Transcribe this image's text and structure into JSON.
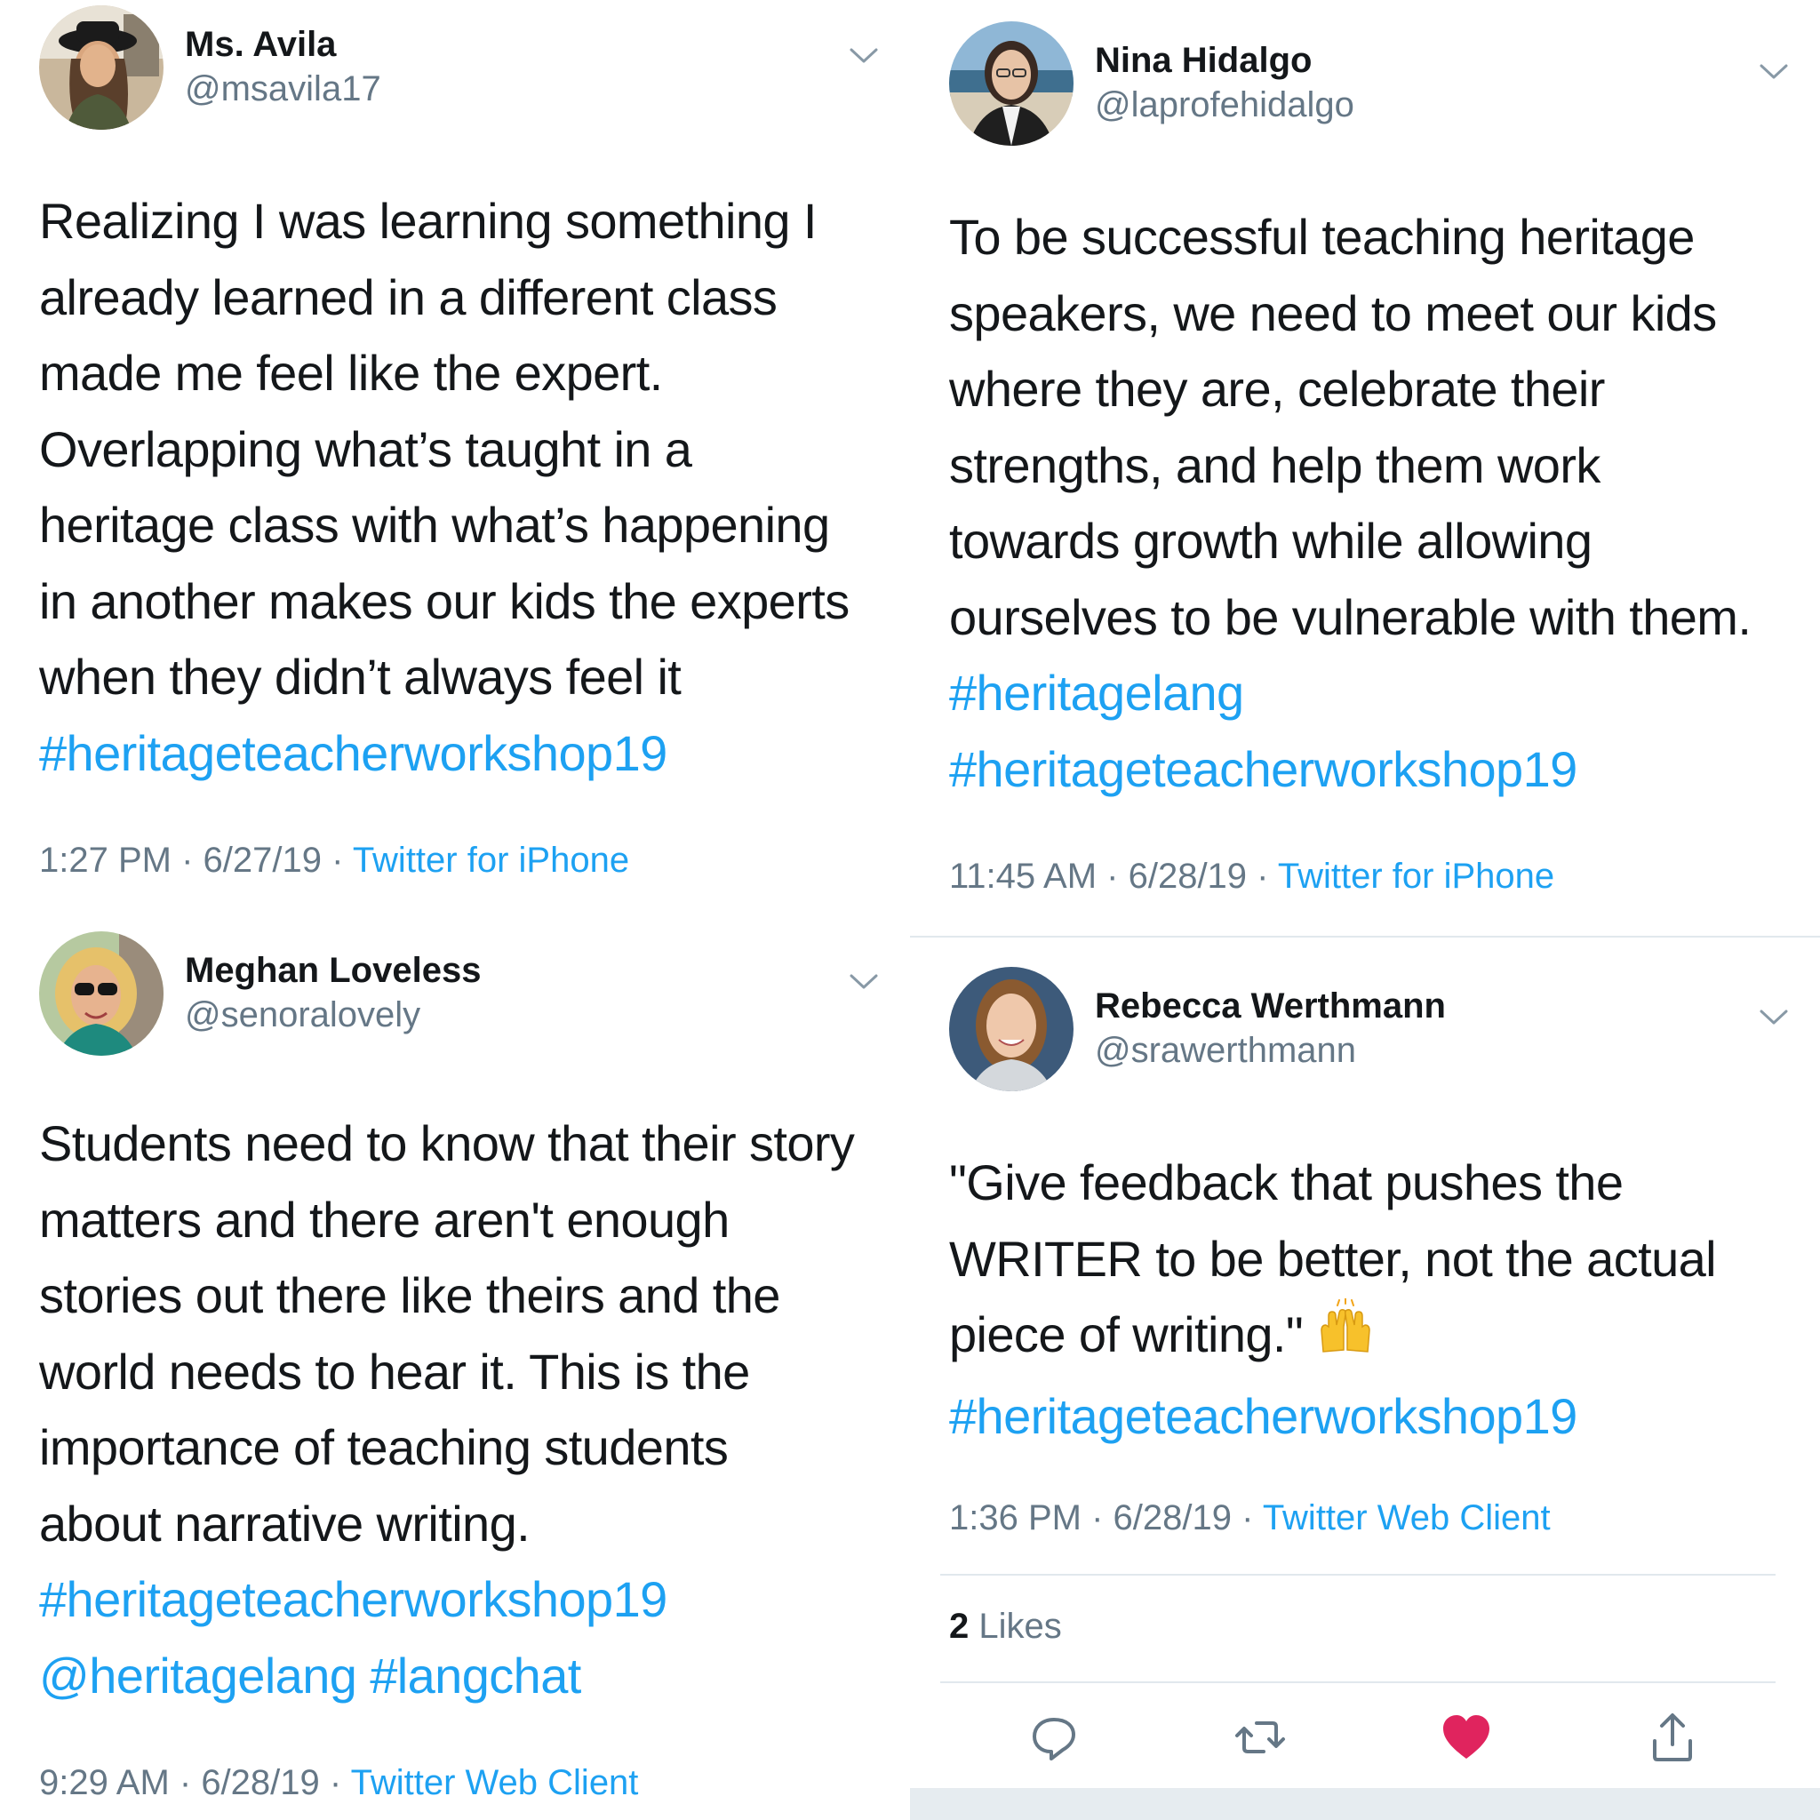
{
  "tweets": [
    {
      "name": "Ms. Avila",
      "handle": "@msavila17",
      "lines": [
        "Realizing I was learning something I",
        "already learned in a different class",
        "made me feel like the expert.",
        "Overlapping what’s taught in a",
        "heritage class with what’s happening",
        "in another makes our kids the experts",
        "when they didn’t always feel it"
      ],
      "hashtags": [
        "#heritageteacherworkshop19"
      ],
      "time": "1:27 PM",
      "date": "6/27/19",
      "source": "Twitter for iPhone"
    },
    {
      "name": "Nina Hidalgo",
      "handle": "@laprofehidalgo",
      "lines": [
        "To be successful teaching heritage",
        "speakers, we need to meet our kids",
        "where they are, celebrate their",
        "strengths, and help them work",
        "towards growth while allowing",
        "ourselves to be vulnerable with them."
      ],
      "hashtags": [
        "#heritagelang",
        "#heritageteacherworkshop19"
      ],
      "time": "11:45 AM",
      "date": "6/28/19",
      "source": "Twitter for iPhone"
    },
    {
      "name": "Meghan Loveless",
      "handle": "@senoralovely",
      "lines": [
        "Students need to know that their story",
        "matters and there aren't enough",
        "stories out there like theirs and the",
        "world needs to hear it. This is the",
        "importance of teaching students",
        "about narrative writing."
      ],
      "hashtags": [
        "#heritageteacherworkshop19",
        "@heritagelang #langchat"
      ],
      "time": "9:29 AM",
      "date": "6/28/19",
      "source": "Twitter Web Client"
    },
    {
      "name": "Rebecca Werthmann",
      "handle": "@srawerthmann",
      "lines": [
        "\"Give feedback that pushes the",
        "WRITER to be better, not the actual",
        "piece of writing.\""
      ],
      "hashtags": [
        "#heritageteacherworkshop19"
      ],
      "time": "1:36 PM",
      "date": "6/28/19",
      "source": "Twitter Web Client",
      "likes_count": "2",
      "likes_label": "Likes"
    }
  ],
  "separator": " · ",
  "icons": {
    "caret": "chevron-down-icon",
    "reply": "reply-icon",
    "retweet": "retweet-icon",
    "like": "heart-icon",
    "share": "share-icon",
    "emoji": "raising-hands-emoji"
  },
  "colors": {
    "link": "#1da1f2",
    "secondary": "#657786",
    "text": "#14171a",
    "liked": "#e0245e",
    "divider": "#e1e8ed"
  }
}
